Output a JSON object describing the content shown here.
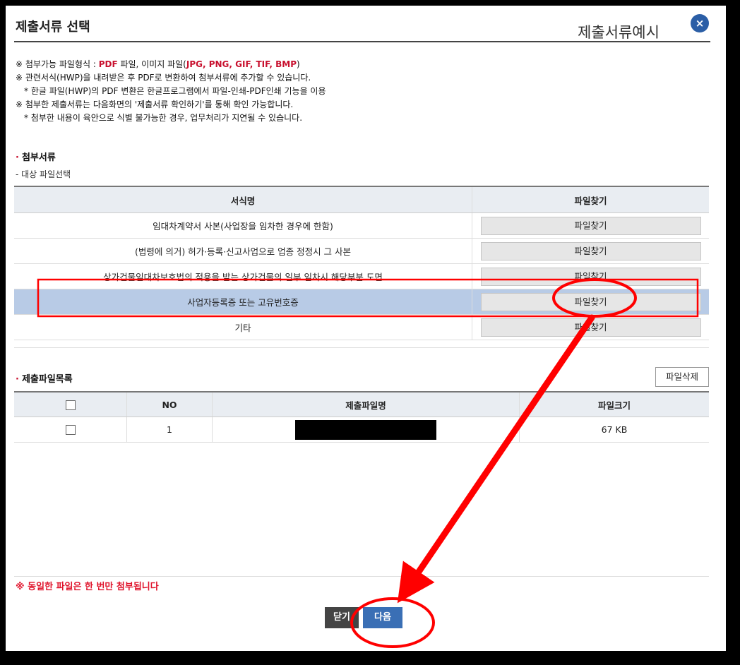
{
  "header": {
    "title": "제출서류 선택",
    "example_link": "제출서류예시",
    "close_glyph": "×"
  },
  "notes": {
    "line1_prefix": "※ 첨부가능 파일형식 : ",
    "line1_pdf": "PDF",
    "line1_mid": " 파일, 이미지 파일(",
    "line1_img": "JPG, PNG, GIF, TIF, BMP",
    "line1_suffix": ")",
    "line2": "※ 관련서식(HWP)을 내려받은 후 PDF로 변환하여 첨부서류에 추가할 수 있습니다.",
    "line3": "* 한글 파일(HWP)의 PDF 변환은 한글프로그램에서 파일-인쇄-PDF인쇄 기능을 이용",
    "line4": "※ 첨부한 제출서류는 다음화면의 '제출서류 확인하기'를 통해 확인 가능합니다.",
    "line5": "* 첨부한 내용이 육안으로 식별 불가능한 경우, 업무처리가 지연될 수 있습니다."
  },
  "attach": {
    "section_title": "첨부서류",
    "subtitle": "- 대상 파일선택",
    "col_name": "서식명",
    "col_find": "파일찾기",
    "rows": [
      {
        "name": "임대차계약서 사본(사업장을 임차한 경우에 한함)",
        "button": "파일찾기"
      },
      {
        "name": "(법령에 의거) 허가·등록·신고사업으로 업종 정정시 그 사본",
        "button": "파일찾기"
      },
      {
        "name": "상가건물임대차보호법의 적용을 받는 상가건물의 일부 임차시 해당부분 도면",
        "button": "파일찾기"
      },
      {
        "name": "사업자등록증 또는 고유번호증",
        "button": "파일찾기"
      },
      {
        "name": "기타",
        "button": "파일찾기"
      }
    ]
  },
  "files": {
    "section_title": "제출파일목록",
    "delete_button": "파일삭제",
    "col_no": "NO",
    "col_filename": "제출파일명",
    "col_size": "파일크기",
    "rows": [
      {
        "no": "1",
        "size": "67 KB"
      }
    ]
  },
  "footer": {
    "warning": "※ 동일한 파일은 한 번만 첨부됩니다",
    "close_button": "닫기",
    "next_button": "다음"
  },
  "colors": {
    "accent": "#3a6fb5",
    "selected_row": "#b8cbe6",
    "warning": "#e0142c",
    "annotation": "#ff0000"
  }
}
